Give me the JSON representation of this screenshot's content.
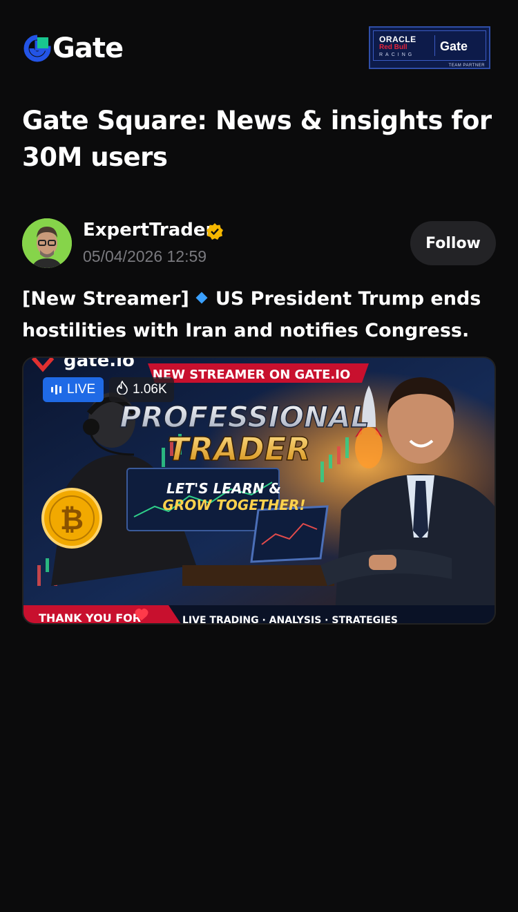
{
  "brand": {
    "name": "Gate",
    "accent": "#2354e6",
    "logo_green": "#18c58f"
  },
  "partner_badge": {
    "line1": "ORACLE",
    "line2": "Red Bull",
    "line3": "RACING",
    "gate": "Gate",
    "caption": "TEAM PARTNER"
  },
  "headline": "Gate Square: News & insights for 30M users",
  "post": {
    "author": "ExpertTrader",
    "verified": true,
    "timestamp": "05/04/2026 12:59",
    "follow_label": "Follow",
    "text_prefix": "[New Streamer]",
    "text_body": "US President Trump ends hostilities with Iran and notifies Congress."
  },
  "media": {
    "live_label": "LIVE",
    "views": "1.06K",
    "banner_top": "NEW STREAMER ON GATE.IO",
    "brand_mark": "gate.io",
    "title_line1": "PROFESSIONAL",
    "title_line2": "TRADER",
    "subtitle_line1": "LET'S LEARN &",
    "subtitle_line2": "GROW TOGETHER!",
    "footer_left": "THANK YOU FOR",
    "footer_right": "LIVE TRADING · ANALYSIS · STRATEGIES"
  }
}
